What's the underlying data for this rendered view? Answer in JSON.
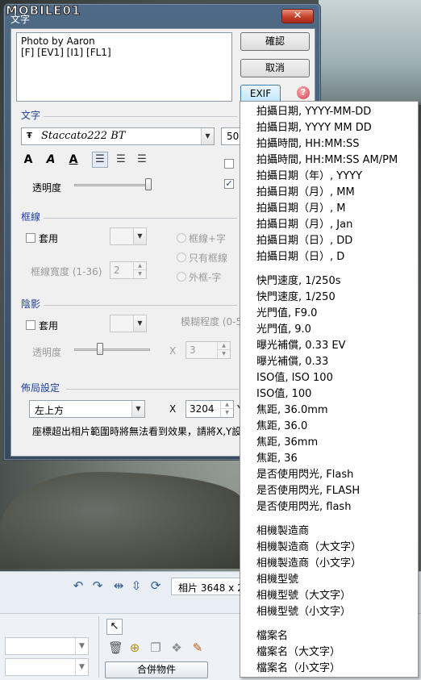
{
  "brand": "MOBILE01",
  "watermark": "#875094",
  "dialog": {
    "title": "文字",
    "close_label": "✕",
    "text_lines": [
      "Photo by Aaron",
      "[F] [EV1] [I1] [FL1]"
    ],
    "ok_label": "確認",
    "cancel_label": "取消",
    "exif_label": "EXIF",
    "help_glyph": "?",
    "text_section": {
      "title": "文字",
      "font_name": "Staccato222 BT",
      "font_glyph": "Ŧ",
      "font_size": "50",
      "bold_glyph": "A",
      "italic_glyph": "A",
      "underline_glyph": "A",
      "opacity_label": "透明度"
    },
    "border_section": {
      "title": "框線",
      "apply_label": "套用",
      "width_label": "框線寬度 (1-36)",
      "width_value": "2",
      "radio_border_text": "框線+字",
      "radio_border_only": "只有框線",
      "radio_outer_text": "外框-字"
    },
    "shadow_section": {
      "title": "陰影",
      "apply_label": "套用",
      "blur_label": "模糊程度 (0-5",
      "opacity_label": "透明度",
      "x_label": "X",
      "x_value": "3"
    },
    "layout_section": {
      "title": "佈局設定",
      "position_value": "左上方",
      "x_label": "X",
      "x_value": "3204",
      "y_partial": "Y",
      "hint": "座標超出相片範圍時將無法看到效果，請將X,Y設"
    }
  },
  "app": {
    "photo_info": "相片 3648 x 2",
    "merge_label": "合併物件",
    "cursor_glyph": "↖"
  },
  "menu": {
    "groups": [
      [
        "拍攝日期, YYYY-MM-DD",
        "拍攝日期, YYYY MM DD",
        "拍攝時間, HH:MM:SS",
        "拍攝時間, HH:MM:SS AM/PM",
        "拍攝日期（年）, YYYY",
        "拍攝日期（月）, MM",
        "拍攝日期（月）, M",
        "拍攝日期（月）, Jan",
        "拍攝日期（日）, DD",
        "拍攝日期（日）, D"
      ],
      [
        "快門速度, 1/250s",
        "快門速度, 1/250",
        "光門值, F9.0",
        "光門值, 9.0",
        "曝光補償, 0.33 EV",
        "曝光補償, 0.33",
        "ISO值, ISO 100",
        "ISO值, 100",
        "焦距, 36.0mm",
        "焦距, 36.0",
        "焦距, 36mm",
        "焦距, 36",
        "是否使用閃光, Flash",
        "是否使用閃光, FLASH",
        "是否使用閃光, flash"
      ],
      [
        "相機製造商",
        "相機製造商（大文字）",
        "相機製造商（小文字）",
        "相機型號",
        "相機型號（大文字）",
        "相機型號（小文字）"
      ],
      [
        "檔案名",
        "檔案名（大文字）",
        "檔案名（小文字）"
      ]
    ]
  }
}
